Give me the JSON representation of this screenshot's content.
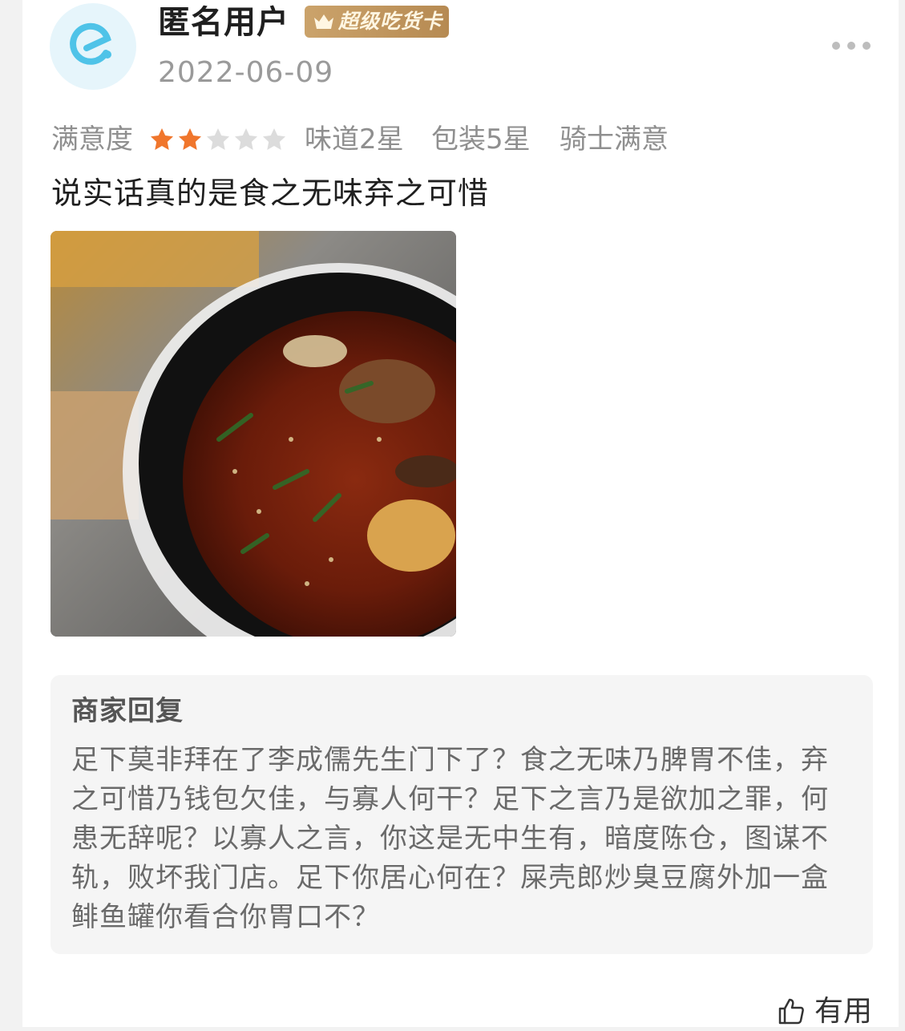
{
  "review": {
    "username": "匿名用户",
    "badge": "超级吃货卡",
    "date": "2022-06-09",
    "satisfaction_label": "满意度",
    "satisfaction_stars": 2,
    "max_stars": 5,
    "taste": "味道2星",
    "packaging": "包装5星",
    "rider": "骑士满意",
    "comment": "说实话真的是食之无味弃之可惜"
  },
  "reply": {
    "title": "商家回复",
    "text": "足下莫非拜在了李成儒先生门下了？食之无味乃脾胃不佳，弃之可惜乃钱包欠佳，与寡人何干？足下之言乃是欲加之罪，何患无辞呢？以寡人之言，你这是无中生有，暗度陈仓，图谋不轨，败坏我门店。足下你居心何在？屎壳郎炒臭豆腐外加一盒鲱鱼罐你看合你胃口不？"
  },
  "actions": {
    "useful_label": "有用"
  },
  "colors": {
    "star_active": "#f0762c",
    "star_inactive": "#dcdcdc",
    "badge_gold": "#c49a60",
    "avatar_accent": "#4fc3e8"
  },
  "icons": [
    "app-logo-icon",
    "crown-icon",
    "more-icon",
    "star-icon",
    "thumbs-up-icon"
  ]
}
